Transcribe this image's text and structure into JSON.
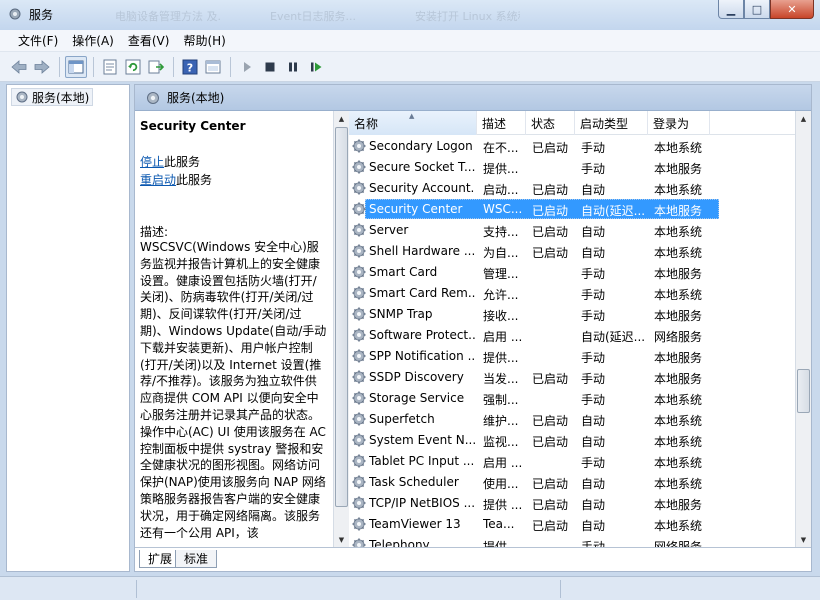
{
  "window": {
    "title": "服务",
    "background_tabs": [
      "电脑设备管理方法 及...",
      "Event日志服务...",
      "安装打开 Linux 系统程序"
    ],
    "minimize_icon": "minimize-icon",
    "maximize_icon": "maximize-icon",
    "close_icon": "close-icon"
  },
  "menu": {
    "items": [
      "文件(F)",
      "操作(A)",
      "查看(V)",
      "帮助(H)"
    ]
  },
  "toolbar": {
    "buttons": [
      "back-arrow-icon",
      "forward-arrow-icon",
      "console-tree-icon",
      "properties-icon",
      "refresh-icon",
      "export-list-icon",
      "help-icon",
      "console-view-icon",
      "start-service-icon",
      "stop-service-icon",
      "pause-service-icon",
      "restart-service-icon"
    ]
  },
  "tree": {
    "root_label": "服务(本地)"
  },
  "panel": {
    "header_title": "服务(本地)"
  },
  "description": {
    "service_name": "Security Center",
    "stop_link": "停止",
    "stop_suffix": "此服务",
    "restart_link": "重启动",
    "restart_suffix": "此服务",
    "label": "描述:",
    "text": "WSCSVC(Windows 安全中心)服务监视并报告计算机上的安全健康设置。健康设置包括防火墙(打开/关闭)、防病毒软件(打开/关闭/过期)、反间谍软件(打开/关闭/过期)、Windows Update(自动/手动下载并安装更新)、用户帐户控制(打开/关闭)以及 Internet 设置(推荐/不推荐)。该服务为独立软件供应商提供 COM API 以便向安全中心服务注册并记录其产品的状态。操作中心(AC) UI 使用该服务在 AC 控制面板中提供 systray 警报和安全健康状况的图形视图。网络访问保护(NAP)使用该服务向 NAP 网络策略服务器报告客户端的安全健康状况，用于确定网络隔离。该服务还有一个公用 API，该"
  },
  "tabs": [
    "扩展",
    "标准"
  ],
  "list": {
    "columns": [
      "名称",
      "描述",
      "状态",
      "启动类型",
      "登录为"
    ],
    "rows": [
      {
        "name": "Secondary Logon",
        "desc": "在不...",
        "status": "已启动",
        "startup": "手动",
        "logon": "本地系统",
        "selected": false
      },
      {
        "name": "Secure Socket T...",
        "desc": "提供...",
        "status": "",
        "startup": "手动",
        "logon": "本地服务",
        "selected": false
      },
      {
        "name": "Security Account...",
        "desc": "启动...",
        "status": "已启动",
        "startup": "自动",
        "logon": "本地系统",
        "selected": false
      },
      {
        "name": "Security Center",
        "desc": "WSC...",
        "status": "已启动",
        "startup": "自动(延迟...",
        "logon": "本地服务",
        "selected": true
      },
      {
        "name": "Server",
        "desc": "支持...",
        "status": "已启动",
        "startup": "自动",
        "logon": "本地系统",
        "selected": false
      },
      {
        "name": "Shell Hardware ...",
        "desc": "为自...",
        "status": "已启动",
        "startup": "自动",
        "logon": "本地系统",
        "selected": false
      },
      {
        "name": "Smart Card",
        "desc": "管理...",
        "status": "",
        "startup": "手动",
        "logon": "本地服务",
        "selected": false
      },
      {
        "name": "Smart Card Rem...",
        "desc": "允许...",
        "status": "",
        "startup": "手动",
        "logon": "本地系统",
        "selected": false
      },
      {
        "name": "SNMP Trap",
        "desc": "接收...",
        "status": "",
        "startup": "手动",
        "logon": "本地服务",
        "selected": false
      },
      {
        "name": "Software Protect...",
        "desc": "启用 ...",
        "status": "",
        "startup": "自动(延迟...",
        "logon": "网络服务",
        "selected": false
      },
      {
        "name": "SPP Notification ...",
        "desc": "提供...",
        "status": "",
        "startup": "手动",
        "logon": "本地服务",
        "selected": false
      },
      {
        "name": "SSDP Discovery",
        "desc": "当发...",
        "status": "已启动",
        "startup": "手动",
        "logon": "本地服务",
        "selected": false
      },
      {
        "name": "Storage Service",
        "desc": "强制...",
        "status": "",
        "startup": "手动",
        "logon": "本地系统",
        "selected": false
      },
      {
        "name": "Superfetch",
        "desc": "维护...",
        "status": "已启动",
        "startup": "自动",
        "logon": "本地系统",
        "selected": false
      },
      {
        "name": "System Event N...",
        "desc": "监视...",
        "status": "已启动",
        "startup": "自动",
        "logon": "本地系统",
        "selected": false
      },
      {
        "name": "Tablet PC Input ...",
        "desc": "启用 ...",
        "status": "",
        "startup": "手动",
        "logon": "本地系统",
        "selected": false
      },
      {
        "name": "Task Scheduler",
        "desc": "使用...",
        "status": "已启动",
        "startup": "自动",
        "logon": "本地系统",
        "selected": false
      },
      {
        "name": "TCP/IP NetBIOS ...",
        "desc": "提供 ...",
        "status": "已启动",
        "startup": "自动",
        "logon": "本地服务",
        "selected": false
      },
      {
        "name": "TeamViewer 13",
        "desc": "Tea...",
        "status": "已启动",
        "startup": "自动",
        "logon": "本地系统",
        "selected": false
      },
      {
        "name": "Telephony",
        "desc": "提供...",
        "status": "",
        "startup": "手动",
        "logon": "网络服务",
        "selected": false
      }
    ]
  }
}
